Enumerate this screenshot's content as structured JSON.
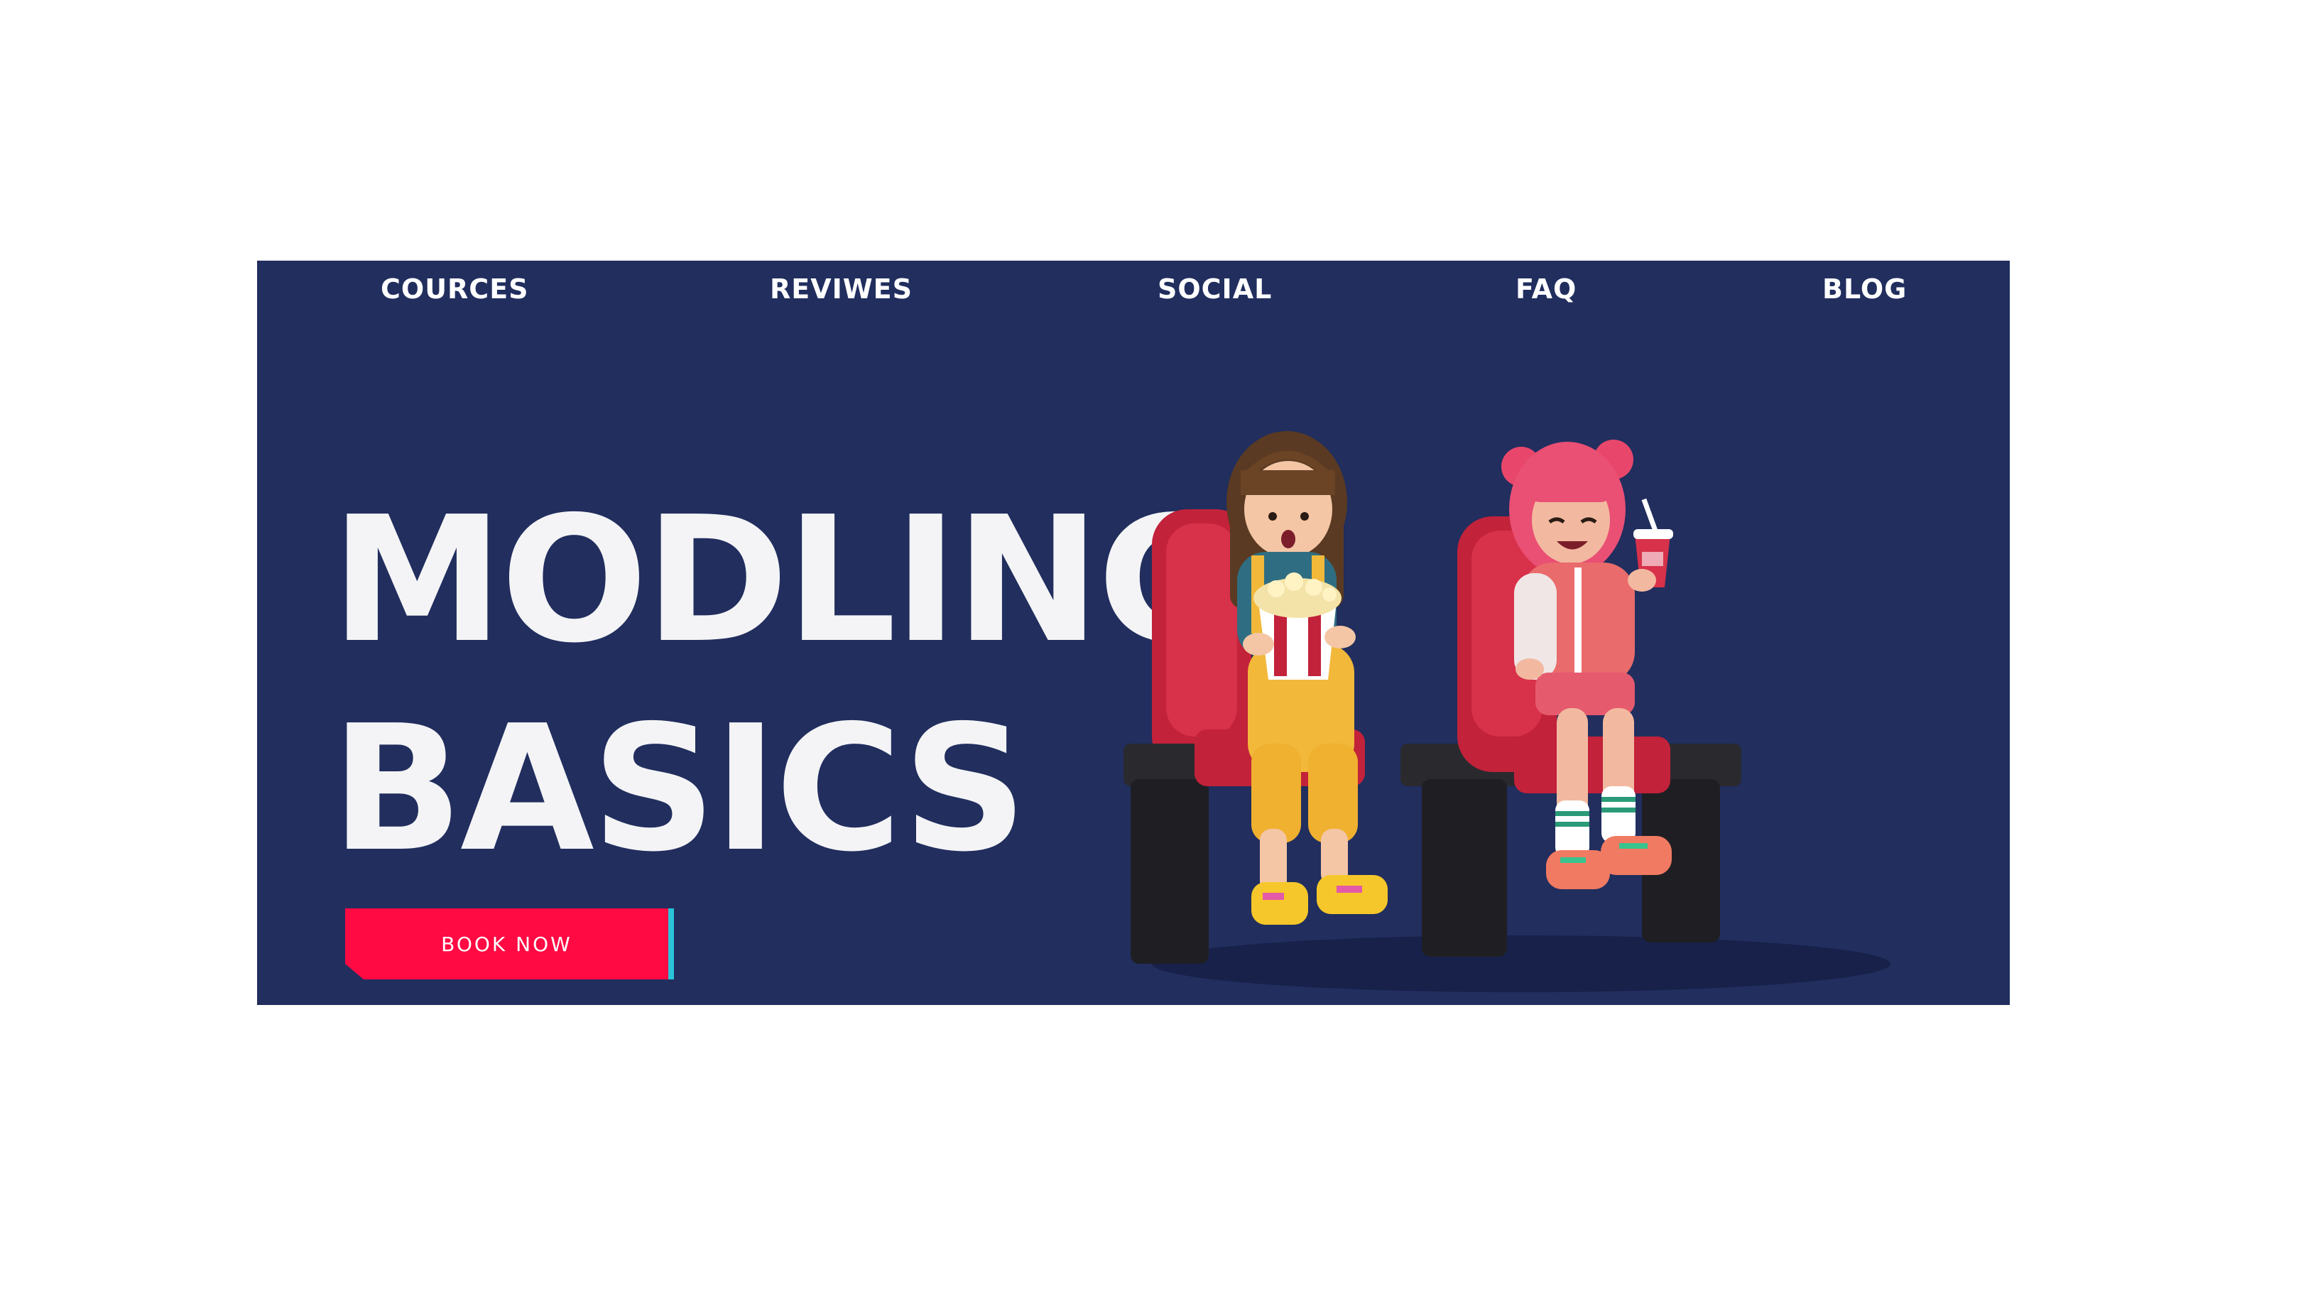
{
  "nav": {
    "items": [
      {
        "label": "COURCES"
      },
      {
        "label": "REVIWES"
      },
      {
        "label": "SOCIAL"
      },
      {
        "label": "FAQ"
      },
      {
        "label": "BLOG"
      }
    ]
  },
  "hero": {
    "title_line1": "MODLING",
    "title_line2": "BASICS",
    "cta_label": "BOOK NOW",
    "image": "two-girls-in-cinema-seats-illustration"
  },
  "colors": {
    "page_background": "#ffffff",
    "hero_background": "#212e5e",
    "headline_text": "#f4f4f6",
    "cta_background": "#ff0a43",
    "cta_accent": "#29c4d8"
  }
}
